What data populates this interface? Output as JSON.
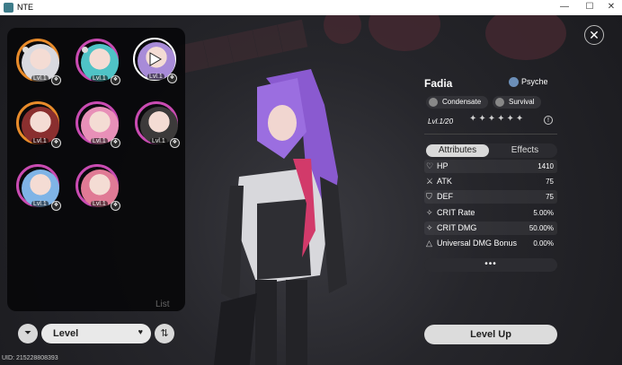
{
  "window": {
    "title": "NTE",
    "minimize": "—",
    "maximize": "☐",
    "close": "✕"
  },
  "roster": {
    "characters": [
      {
        "name": "white-haired-character",
        "level": "Lvl.1",
        "ring": "#e88b2a",
        "face": "#d9d9df",
        "locked": true,
        "element": "❖"
      },
      {
        "name": "teal-haired-character",
        "level": "Lvl.1",
        "ring": "#c94bb2",
        "face": "#4fc3c6",
        "locked": true,
        "element": "❖"
      },
      {
        "name": "fadia",
        "level": "Lvl.1",
        "ring": "#e8b96a",
        "face": "#a88bd8",
        "locked": false,
        "selected": true,
        "element": "❖"
      },
      {
        "name": "dark-red-haired-character",
        "level": "Lvl.1",
        "ring": "#e88b2a",
        "face": "#8a2f2f",
        "locked": false,
        "element": "❖"
      },
      {
        "name": "pink-haired-character",
        "level": "Lvl.1",
        "ring": "#c94bb2",
        "face": "#e890b8",
        "locked": false,
        "element": "❖"
      },
      {
        "name": "dog-character",
        "level": "Lvl.1",
        "ring": "#c94bb2",
        "face": "#3c3a3a",
        "locked": false,
        "element": "❖"
      },
      {
        "name": "blue-haired-character",
        "level": "Lvl.1",
        "ring": "#c94bb2",
        "face": "#7fb4e6",
        "locked": false,
        "element": "❖"
      },
      {
        "name": "rose-haired-character",
        "level": "Lvl.1",
        "ring": "#c94bb2",
        "face": "#e07a95",
        "locked": false,
        "element": "❖"
      }
    ],
    "list_label": "List"
  },
  "sort": {
    "filter_icon": "funnel-icon",
    "filter_glyph": "⏷",
    "level_label": "Level",
    "caret": "♥",
    "sort_icon": "sort-icon",
    "sort_glyph": "⇅"
  },
  "uid": "UID: 215228808393",
  "close_glyph": "✕",
  "character": {
    "name": "Fadia",
    "attribute": "Psyche",
    "tags": [
      "Condensate",
      "Survival"
    ],
    "level_text": "Lvl.1/20",
    "stars": "✦✦✦✦✦✦",
    "info_glyph": "!"
  },
  "tabs": {
    "attributes": "Attributes",
    "effects": "Effects"
  },
  "stats": [
    {
      "icon": "heart-icon",
      "glyph": "♡",
      "name": "HP",
      "value": "1410"
    },
    {
      "icon": "sword-icon",
      "glyph": "⚔",
      "name": "ATK",
      "value": "75"
    },
    {
      "icon": "shield-icon",
      "glyph": "⛉",
      "name": "DEF",
      "value": "75"
    },
    {
      "icon": "crit-icon",
      "glyph": "✧",
      "name": "CRIT Rate",
      "value": "5.00%"
    },
    {
      "icon": "crit-icon",
      "glyph": "✧",
      "name": "CRIT DMG",
      "value": "50.00%"
    },
    {
      "icon": "triangle-icon",
      "glyph": "△",
      "name": "Universal DMG Bonus",
      "value": "0.00%"
    }
  ],
  "more_label": "•••",
  "level_up_label": "Level Up",
  "colors": {
    "accent_purple": "#8a5ad0",
    "panel_bg": "#0a0a0c",
    "button_light": "#dcdcdc"
  }
}
